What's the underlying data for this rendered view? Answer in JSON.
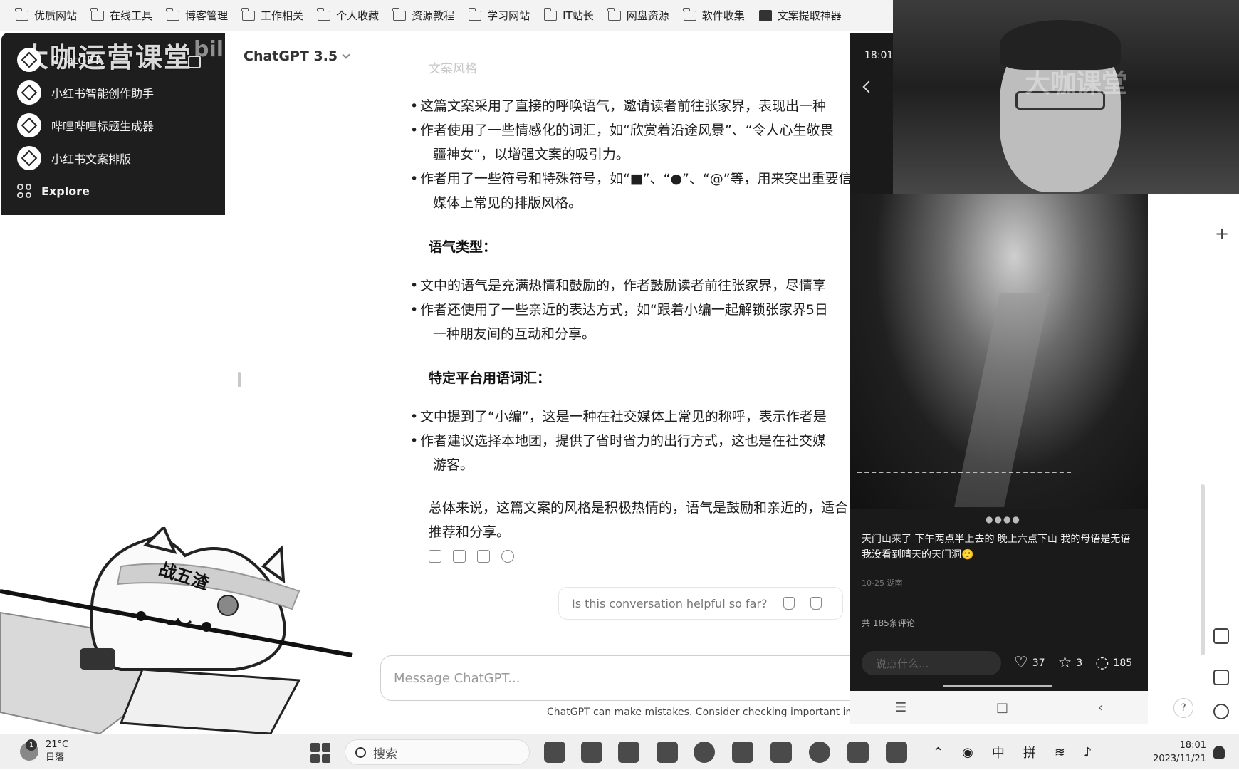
{
  "bookmarks": [
    {
      "label": "优质网站",
      "icon": "folder-icon"
    },
    {
      "label": "在线工具",
      "icon": "folder-icon"
    },
    {
      "label": "博客管理",
      "icon": "folder-icon"
    },
    {
      "label": "工作相关",
      "icon": "folder-icon"
    },
    {
      "label": "个人收藏",
      "icon": "folder-icon"
    },
    {
      "label": "资源教程",
      "icon": "folder-icon"
    },
    {
      "label": "学习网站",
      "icon": "folder-icon"
    },
    {
      "label": "IT站长",
      "icon": "folder-icon"
    },
    {
      "label": "网盘资源",
      "icon": "folder-icon"
    },
    {
      "label": "软件收集",
      "icon": "folder-icon"
    },
    {
      "label": "文案提取神器",
      "icon": "tool-icon"
    }
  ],
  "sidebar": {
    "watermark": "大咖运营课堂",
    "watermark_small": "bilibili",
    "chatgpt_label": "ChatGPT",
    "items": [
      {
        "label": "小红书智能创作助手"
      },
      {
        "label": "哔哩哔哩标题生成器"
      },
      {
        "label": "小红书文案排版"
      }
    ],
    "explore_label": "Explore"
  },
  "chat": {
    "model": "ChatGPT 3.5",
    "faded_heading": "文案风格",
    "style_bullets": [
      "这篇文案采用了直接的呼唤语气，邀请读者前往张家界，表现出一种",
      "作者使用了一些情感化的词汇，如“欣赏着沿途风景”、“令人心生敬畏",
      "疆神女”，以增强文案的吸引力。",
      "作者用了一些符号和特殊符号，如“■”、“●”、“@”等，用来突出重要信",
      "媒体上常见的排版风格。"
    ],
    "tone_heading": "语气类型",
    "tone_bullets": [
      "文中的语气是充满热情和鼓励的，作者鼓励读者前往张家界，尽情享",
      "作者还使用了一些亲近的表达方式，如“跟着小编一起解锁张家界5日",
      "一种朋友间的互动和分享。"
    ],
    "platform_heading": "特定平台用语词汇",
    "platform_bullets": [
      "文中提到了“小编”，这是一种在社交媒体上常见的称呼，表示作者是",
      "作者建议选择本地团，提供了省时省力的出行方式，这也是在社交媒",
      "游客。"
    ],
    "summary": [
      "总体来说，这篇文案的风格是积极热情的，语气是鼓励和亲近的，适合",
      "推荐和分享。"
    ],
    "feedback_prompt": "Is this conversation helpful so far?",
    "composer_placeholder": "Message ChatGPT...",
    "disclaimer": "ChatGPT can make mistakes. Consider checking important inform"
  },
  "cat_sticker": {
    "headband_text": "战五渣"
  },
  "phone": {
    "time": "18:01",
    "caption": "天门山来了 下午两点半上去的 晚上六点下山 我的母语是无语 我没看到晴天的天门洞🙂",
    "date": "10-25 湖南",
    "comment_count_label": "共 185条评论",
    "input_placeholder": "说点什么...",
    "likes": "37",
    "stars": "3",
    "comments": "185"
  },
  "webcam": {
    "watermark": "大咖课堂"
  },
  "taskbar": {
    "weather_temp": "21°C",
    "weather_desc": "日落",
    "weather_badge": "1",
    "search_label": "搜索",
    "tray_ime_1": "中",
    "tray_ime_2": "拼",
    "clock_time": "18:01",
    "clock_date": "2023/11/21"
  },
  "help_label": "?"
}
